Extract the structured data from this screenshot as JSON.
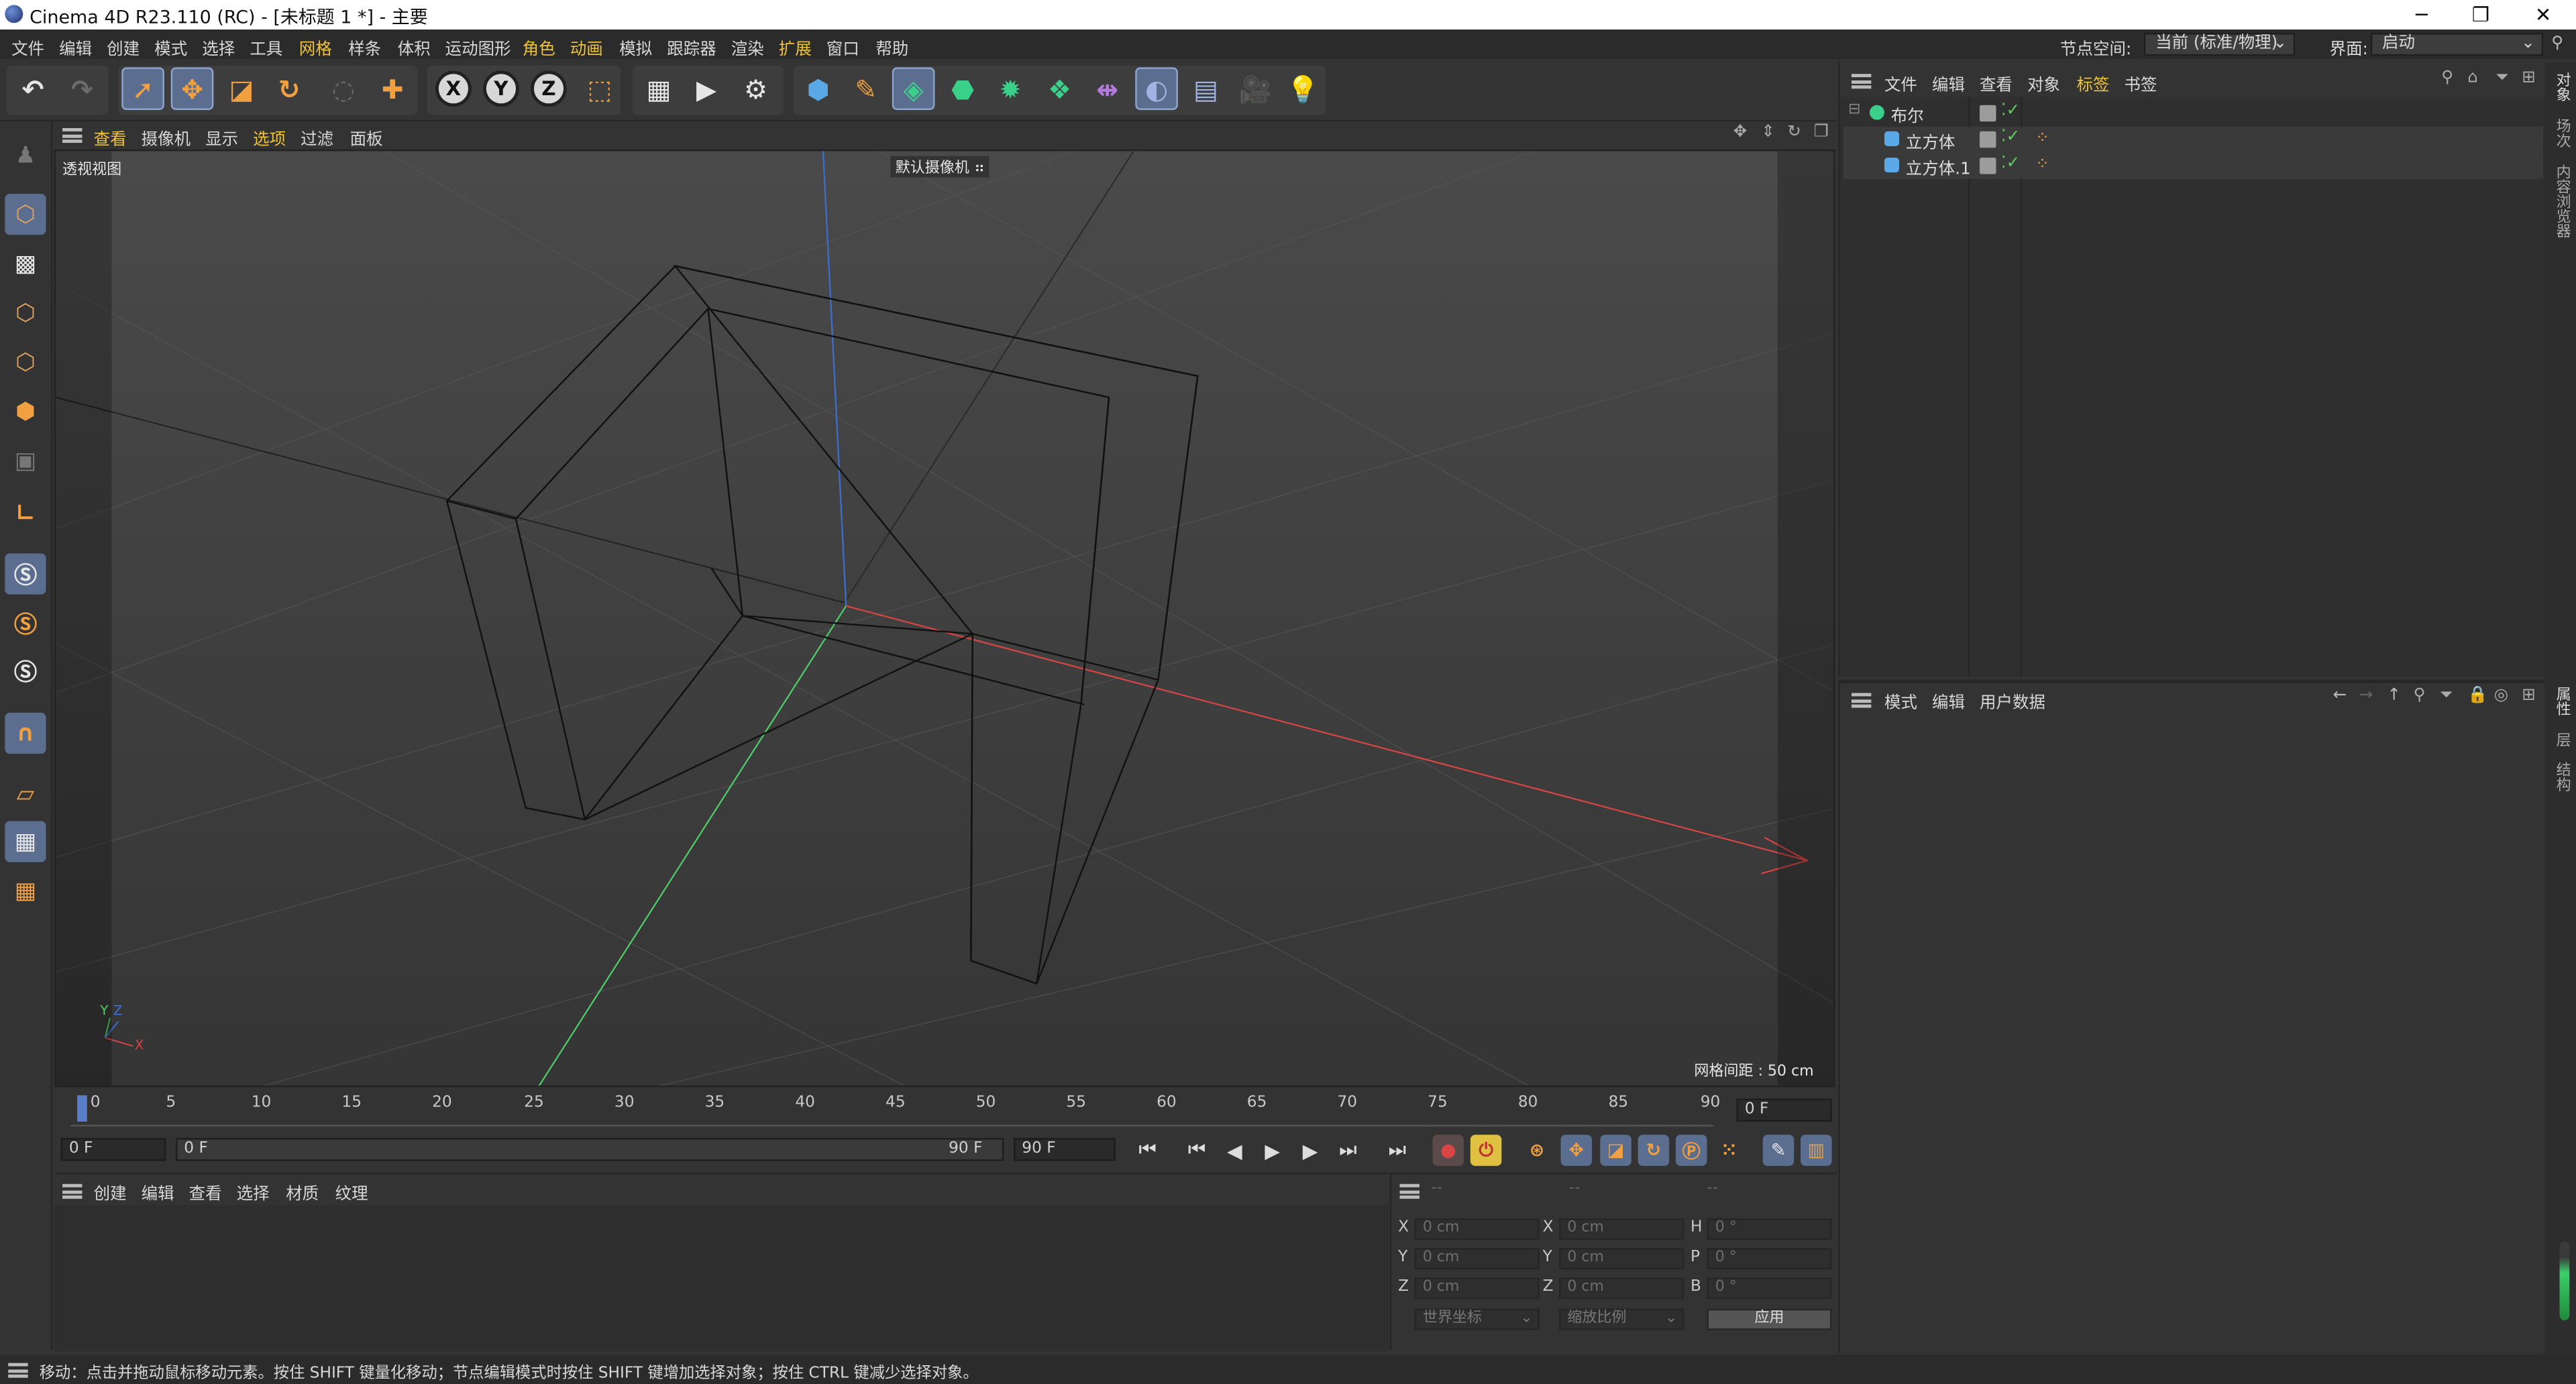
{
  "window": {
    "title": "Cinema 4D R23.110 (RC) - [未标题 1 *] - 主要",
    "controls": [
      "─",
      "❐",
      "✕"
    ]
  },
  "menubar": {
    "items": [
      "文件",
      "编辑",
      "创建",
      "模式",
      "选择",
      "工具",
      "网格",
      "样条",
      "体积",
      "运动图形",
      "角色",
      "动画",
      "模拟",
      "跟踪器",
      "渲染",
      "扩展",
      "窗口",
      "帮助"
    ],
    "highlighted": [
      "网格",
      "角色",
      "动画",
      "扩展"
    ],
    "node_space_label": "节点空间:",
    "node_space_value": "当前 (标准/物理)",
    "layout_label": "界面:",
    "layout_value": "启动"
  },
  "viewport": {
    "menu": [
      "查看",
      "摄像机",
      "显示",
      "选项",
      "过滤",
      "面板"
    ],
    "view_name": "透视视图",
    "camera_label": "默认摄像机",
    "grid_spacing": "网格间距 : 50 cm",
    "axis_y": "Y",
    "axis_z": "Z",
    "axis_x": "X"
  },
  "timeline": {
    "ticks": [
      "0",
      "5",
      "10",
      "15",
      "20",
      "25",
      "30",
      "35",
      "40",
      "45",
      "50",
      "55",
      "60",
      "65",
      "70",
      "75",
      "80",
      "85",
      "90"
    ],
    "current_frame": "0 F",
    "start_field": "0 F",
    "range_start": "0 F",
    "range_end": "90 F",
    "end_field": "90 F"
  },
  "material_manager": {
    "menu": [
      "创建",
      "编辑",
      "查看",
      "选择",
      "材质",
      "纹理"
    ]
  },
  "coordinates": {
    "headers": [
      "--",
      "--",
      "--"
    ],
    "rows": [
      {
        "label1": "X",
        "v1": "0 cm",
        "label2": "X",
        "v2": "0 cm",
        "label3": "H",
        "v3": "0 °"
      },
      {
        "label1": "Y",
        "v1": "0 cm",
        "label2": "Y",
        "v2": "0 cm",
        "label3": "P",
        "v3": "0 °"
      },
      {
        "label1": "Z",
        "v1": "0 cm",
        "label2": "Z",
        "v2": "0 cm",
        "label3": "B",
        "v3": "0 °"
      }
    ],
    "mode_dropdown": "世界坐标",
    "scale_dropdown": "缩放比例",
    "apply_button": "应用"
  },
  "object_manager": {
    "menu": [
      "文件",
      "编辑",
      "查看",
      "对象",
      "标签",
      "书签"
    ],
    "highlighted": "标签",
    "objects": [
      {
        "name": "布尔",
        "level": 0
      },
      {
        "name": "立方体",
        "level": 1
      },
      {
        "name": "立方体.1",
        "level": 1
      }
    ]
  },
  "attribute_manager": {
    "menu": [
      "模式",
      "编辑",
      "用户数据"
    ]
  },
  "side_tabs": {
    "top": [
      "对象",
      "场次",
      "内容浏览器"
    ],
    "bottom": [
      "属性",
      "层",
      "结构"
    ]
  },
  "status_bar": {
    "text": "移动：点击并拖动鼠标移动元素。按住 SHIFT 键量化移动；节点编辑模式时按住 SHIFT 键增加选择对象；按住 CTRL 键减少选择对象。"
  }
}
